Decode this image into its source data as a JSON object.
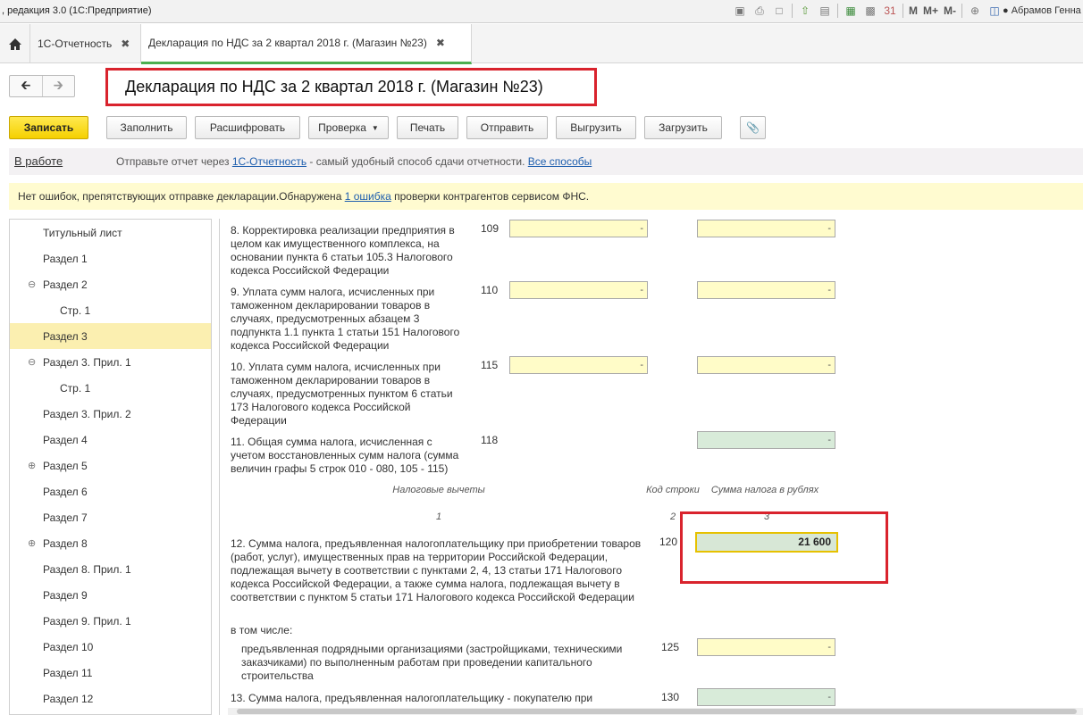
{
  "window": {
    "title": ", редакция 3.0  (1С:Предприятие)",
    "user": "Абрамов Генна",
    "memory_buttons": [
      "M",
      "M+",
      "M-"
    ]
  },
  "tabs": [
    {
      "label": "1С-Отчетность"
    },
    {
      "label": "Декларация по НДС за 2 квартал 2018 г. (Магазин №23)"
    }
  ],
  "header": {
    "title": "Декларация по НДС за 2 квартал 2018 г. (Магазин №23)"
  },
  "toolbar": {
    "save": "Записать",
    "fill": "Заполнить",
    "decode": "Расшифровать",
    "check": "Проверка",
    "print": "Печать",
    "send": "Отправить",
    "export": "Выгрузить",
    "import": "Загрузить"
  },
  "status": {
    "state": "В работе",
    "msg_prefix": "Отправьте отчет через ",
    "link1": "1С-Отчетность",
    "msg_middle": " - самый удобный способ сдачи отчетности. ",
    "link2": "Все способы"
  },
  "warning": {
    "prefix": "Нет ошибок, препятствующих отправке декларации.Обнаружена ",
    "link": "1 ошибка",
    "suffix": " проверки контрагентов сервисом ФНС."
  },
  "sidebar": {
    "items": [
      "Титульный лист",
      "Раздел 1",
      "Раздел 2",
      "Стр. 1",
      "Раздел 3",
      "Раздел 3. Прил. 1",
      "Стр. 1",
      "Раздел 3. Прил. 2",
      "Раздел 4",
      "Раздел 5",
      "Раздел 6",
      "Раздел 7",
      "Раздел 8",
      "Раздел 8. Прил. 1",
      "Раздел 9",
      "Раздел 9. Прил. 1",
      "Раздел 10",
      "Раздел 11",
      "Раздел 12"
    ],
    "selected": "Раздел 3"
  },
  "form": {
    "rows": [
      {
        "text": "8. Корректировка реализации предприятия в целом как имущественного комплекса, на основании пункта 6 статьи 105.3 Налогового кодекса Российской Федерации",
        "code": "109",
        "v1": "-",
        "v2": "-"
      },
      {
        "text": "9. Уплата сумм налога, исчисленных при таможенном декларировании товаров в случаях, предусмотренных абзацем 3 подпункта 1.1 пункта 1 статьи 151 Налогового кодекса Российской Федерации",
        "code": "110",
        "v1": "-",
        "v2": "-"
      },
      {
        "text": "10. Уплата сумм налога, исчисленных при таможенном декларировании товаров в случаях, предусмотренных пунктом 6 статьи 173 Налогового кодекса Российской Федерации",
        "code": "115",
        "v1": "-",
        "v2": "-"
      },
      {
        "text": "11. Общая сумма налога, исчисленная с учетом восстановленных сумм налога (сумма величин графы 5 строк 010 - 080, 105 - 115)",
        "code": "118",
        "v2": "-"
      }
    ],
    "deductions_header": {
      "col1": "Налоговые вычеты",
      "col2": "Код строки",
      "col3": "Сумма налога в рублях",
      "n1": "1",
      "n2": "2",
      "n3": "3"
    },
    "row12": {
      "text": "12. Сумма налога, предъявленная налогоплательщику при приобретении товаров (работ, услуг), имущественных прав на территории Российской Федерации, подлежащая вычету в соответствии с пунктами 2, 4, 13 статьи 171 Налогового кодекса Российской Федерации, а также сумма налога, подлежащая вычету в соответствии с пунктом 5 статьи 171 Налогового кодекса Российской Федерации",
      "code": "120",
      "value": "21 600"
    },
    "including": "в том числе:",
    "row125": {
      "text": "предъявленная подрядными организациями (застройщиками, техническими заказчиками) по выполненным работам при проведении капитального строительства",
      "code": "125",
      "value": "-"
    },
    "row13": {
      "text": "13. Сумма налога, предъявленная налогоплательщику - покупателю при",
      "code": "130",
      "value": "-"
    }
  }
}
